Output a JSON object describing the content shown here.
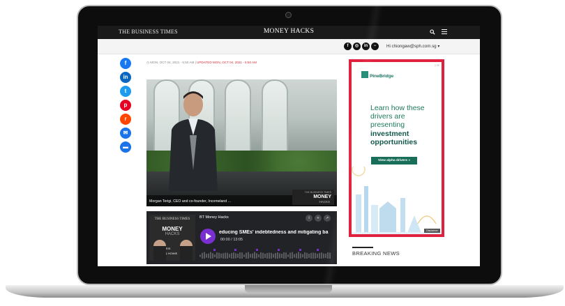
{
  "header": {
    "brand": "THE BUSINESS TIMES",
    "section": "MONEY HACKS"
  },
  "userbar": {
    "social_icons": [
      "facebook-icon",
      "whatsapp-icon",
      "linkedin-icon",
      "minus-circle-icon"
    ],
    "user_label": "Hi chiongaw@sph.com.sg ▾"
  },
  "share": {
    "icons": [
      "facebook",
      "linkedin",
      "twitter",
      "pinterest",
      "reddit",
      "email",
      "print"
    ],
    "colors": {
      "facebook": "#1877f2",
      "linkedin": "#0a66c2",
      "twitter": "#1d9bf0",
      "pinterest": "#e60023",
      "reddit": "#ff4500",
      "email": "#1a73e8",
      "print": "#1a73e8"
    }
  },
  "article": {
    "date": "MON, OCT 04, 2021 - 5:50 AM",
    "updated": "UPDATED MON, OCT 04, 2021 - 5:50 AM",
    "photo_caption": "Morgan Terigi, CEO and co-founder, Incomeland ..."
  },
  "photo_badge": {
    "line1": "THE BUSINESS TIMES",
    "line2": "MONEY",
    "line3": "HACKS"
  },
  "podcast": {
    "cover_brand": "THE BUSINESS TIMES",
    "cover_title": "MONEY",
    "cover_subtitle": "HACKS",
    "cover_with": "WITH",
    "cover_host1": "CHRIS",
    "cover_host2": "& HOWIE",
    "show_name": "BT Money Hacks",
    "episode_title": "educing SMEs' indebtedness and mitigating ba",
    "time": "00:00 / 13:05",
    "accent": "#7a2fd0"
  },
  "ad": {
    "brand": "PineBridge",
    "brand_sub": "INVESTMENTS",
    "headline_plain": "Learn how these drivers are presenting",
    "headline_bold": "investment opportunities",
    "cta": "View alpha drivers »",
    "disclaimer": "Disclaimer",
    "border_color": "#e0213e",
    "text_color": "#1f7a5c"
  },
  "sidebar": {
    "breaking_news": "BREAKING NEWS"
  }
}
